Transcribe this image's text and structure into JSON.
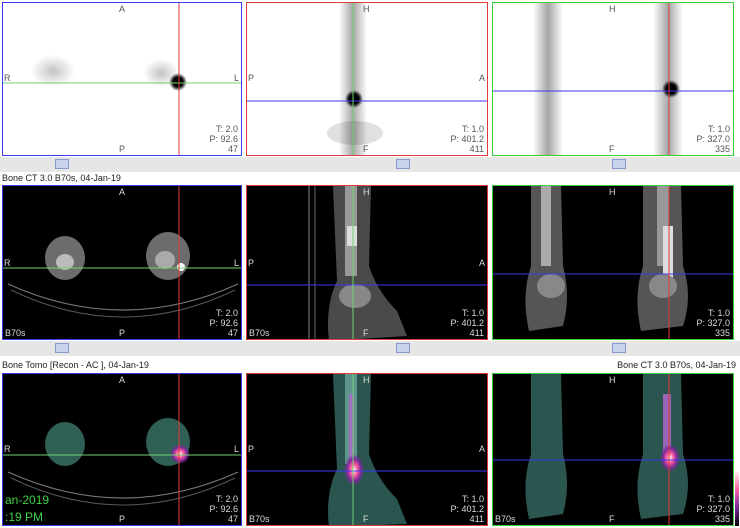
{
  "rows": [
    {
      "title_left": "",
      "title_right": "",
      "viewports": [
        {
          "name": "nm-axial",
          "top": "A",
          "left": "R",
          "right": "L",
          "bottom": "P",
          "t": "T: 2.0",
          "p": "P: 92.6",
          "slice": "47",
          "series": ""
        },
        {
          "name": "nm-sagittal",
          "top": "H",
          "left": "P",
          "right": "A",
          "bottom": "F",
          "t": "T: 1.0",
          "p": "P: 401.2",
          "slice": "411",
          "series": ""
        },
        {
          "name": "nm-coronal",
          "top": "H",
          "left": "",
          "right": "",
          "bottom": "F",
          "t": "T: 1.0",
          "p": "P: 327.0",
          "slice": "335",
          "series": ""
        }
      ]
    },
    {
      "title_left": "Bone CT  3.0  B70s, 04-Jan-19",
      "title_right": "",
      "viewports": [
        {
          "name": "ct-axial",
          "top": "A",
          "left": "R",
          "right": "L",
          "bottom": "P",
          "t": "T: 2.0",
          "p": "P: 92.6",
          "slice": "47",
          "series": "B70s"
        },
        {
          "name": "ct-sagittal",
          "top": "H",
          "left": "P",
          "right": "A",
          "bottom": "F",
          "t": "T: 1.0",
          "p": "P: 401.2",
          "slice": "411",
          "series": "B70s"
        },
        {
          "name": "ct-coronal",
          "top": "H",
          "left": "",
          "right": "",
          "bottom": "",
          "t": "T: 1.0",
          "p": "P: 327.0",
          "slice": "335",
          "series": ""
        }
      ]
    },
    {
      "title_left": "Bone Tomo [Recon - AC ], 04-Jan-19",
      "title_right": "Bone CT  3.0  B70s, 04-Jan-19",
      "viewports": [
        {
          "name": "fusion-axial",
          "top": "A",
          "left": "R",
          "right": "L",
          "bottom": "P",
          "t": "T: 2.0",
          "p": "P: 92.6",
          "slice": "47",
          "series": ""
        },
        {
          "name": "fusion-sagittal",
          "top": "H",
          "left": "P",
          "right": "A",
          "bottom": "F",
          "t": "T: 1.0",
          "p": "P: 401.2",
          "slice": "411",
          "series": "B70s"
        },
        {
          "name": "fusion-coronal",
          "top": "H",
          "left": "",
          "right": "",
          "bottom": "F",
          "t": "T: 1.0",
          "p": "P: 327.0",
          "slice": "335",
          "series": "B70s"
        }
      ]
    }
  ],
  "overlay": {
    "date": "an-2019",
    "time": ":19 PM"
  },
  "colors": {
    "axial_border": "#3a3af0",
    "sagittal_border": "#e03a3a",
    "coronal_border": "#3ccf3c"
  }
}
